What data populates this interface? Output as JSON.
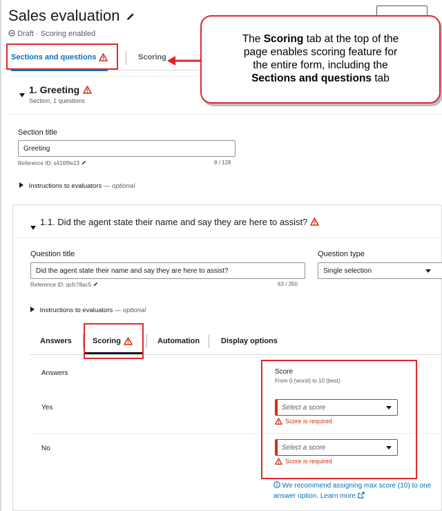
{
  "header": {
    "title": "Sales evaluation",
    "status_draft": "Draft",
    "status_sep": "·",
    "status_scoring": "Scoring enabled"
  },
  "top_tabs": [
    {
      "label": "Sections and questions",
      "active": true,
      "warning": true
    },
    {
      "label": "Scoring",
      "active": false,
      "warning": false
    }
  ],
  "callout": {
    "line1_pre": "The ",
    "line1_bold": "Scoring",
    "line1_post": " tab at the top of the",
    "line2": "page enables scoring feature for",
    "line3": "the entire form, including the",
    "line4_bold": "Sections and questions",
    "line4_post": " tab"
  },
  "section": {
    "title": "1. Greeting",
    "subtitle": "Section, 1 questions",
    "field_label": "Section title",
    "field_value": "Greeting",
    "reference_id": "Reference ID: s416f9e23",
    "char_count": "8 / 128",
    "instructions_label": "Instructions to evaluators",
    "instructions_optional": "— optional"
  },
  "question": {
    "title": "1.1. Did the agent state their name and say they are here to assist?",
    "title_label": "Question title",
    "title_value": "Did the agent state their name and say they are here to assist?",
    "reference_id": "Reference ID: qcfc78ac5",
    "char_count": "63 / 350",
    "type_label": "Question type",
    "type_value": "Single selection",
    "instructions_label": "Instructions to evaluators",
    "instructions_optional": "— optional"
  },
  "inner_tabs": [
    {
      "label": "Answers"
    },
    {
      "label": "Scoring",
      "warning": true
    },
    {
      "label": "Automation"
    },
    {
      "label": "Display options"
    }
  ],
  "scoring": {
    "answers_header": "Answers",
    "score_header": "Score",
    "score_hint": "From 0 (worst) to 10 (best)",
    "rows": [
      {
        "answer": "Yes",
        "placeholder": "Select a score",
        "error": "Score is required"
      },
      {
        "answer": "No",
        "placeholder": "Select a score",
        "error": "Score is required"
      }
    ],
    "recommendation": "We recommend assigning max score (10) to one answer option. Learn more"
  },
  "colors": {
    "accent": "#0073bb",
    "error": "#d13212",
    "highlight": "#e0262d"
  }
}
